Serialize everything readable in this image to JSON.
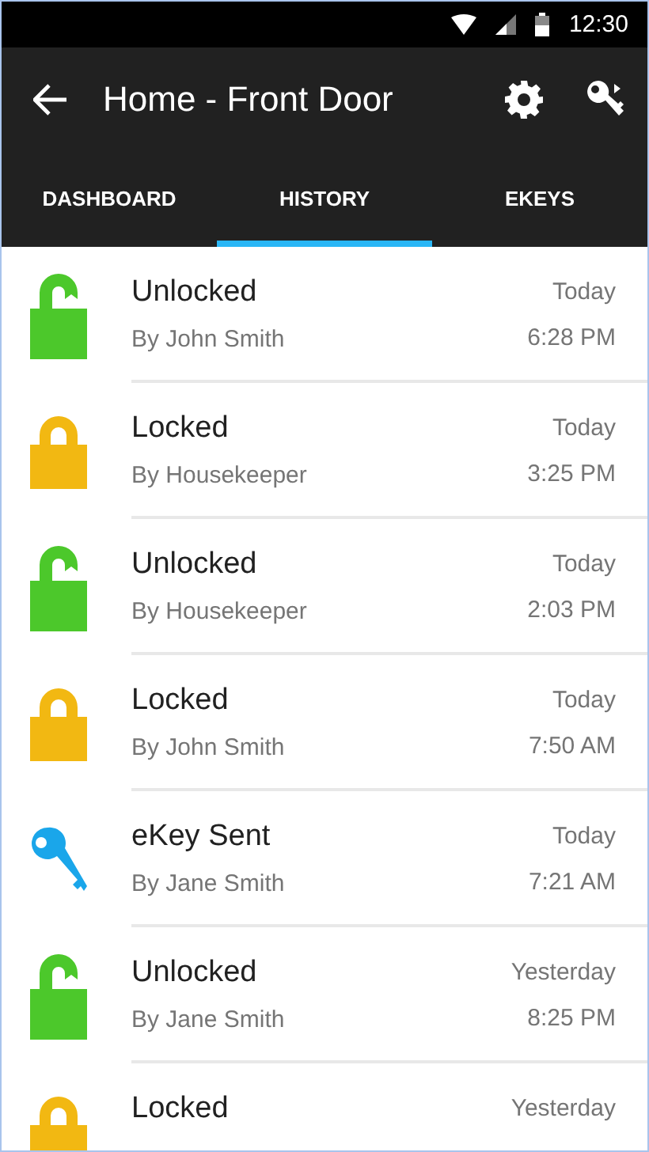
{
  "status_bar": {
    "time": "12:30"
  },
  "app_bar": {
    "title": "Home - Front Door"
  },
  "tabs": [
    {
      "label": "DASHBOARD",
      "selected": false
    },
    {
      "label": "HISTORY",
      "selected": true
    },
    {
      "label": "EKEYS",
      "selected": false
    }
  ],
  "history": [
    {
      "kind": "unlocked",
      "title": "Unlocked",
      "by": "By John Smith",
      "day": "Today",
      "time": "6:28 PM"
    },
    {
      "kind": "locked",
      "title": "Locked",
      "by": "By Housekeeper",
      "day": "Today",
      "time": "3:25 PM"
    },
    {
      "kind": "unlocked",
      "title": "Unlocked",
      "by": "By Housekeeper",
      "day": "Today",
      "time": "2:03 PM"
    },
    {
      "kind": "locked",
      "title": "Locked",
      "by": "By John Smith",
      "day": "Today",
      "time": "7:50 AM"
    },
    {
      "kind": "ekey",
      "title": "eKey Sent",
      "by": "By Jane Smith",
      "day": "Today",
      "time": "7:21 AM"
    },
    {
      "kind": "unlocked",
      "title": "Unlocked",
      "by": "By Jane Smith",
      "day": "Yesterday",
      "time": "8:25 PM"
    },
    {
      "kind": "locked",
      "title": "Locked",
      "day": "Yesterday"
    }
  ]
}
